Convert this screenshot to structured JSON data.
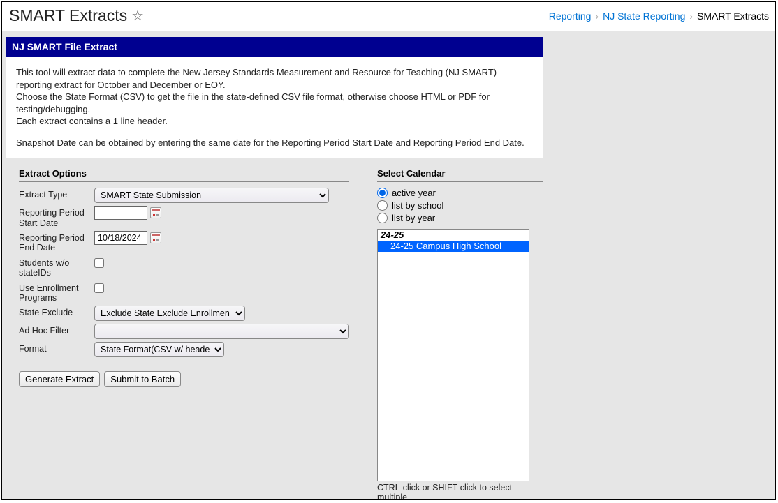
{
  "header": {
    "title": "SMART Extracts",
    "breadcrumb": {
      "reporting": "Reporting",
      "state_reporting": "NJ State Reporting",
      "current": "SMART Extracts"
    }
  },
  "panel": {
    "heading": "NJ SMART File Extract"
  },
  "intro": {
    "para1": "This tool will extract data to complete the New Jersey Standards Measurement and Resource for Teaching (NJ SMART) reporting extract for October and December or EOY.",
    "para2": "Choose the State Format (CSV) to get the file in the state-defined CSV file format, otherwise choose HTML or PDF for testing/debugging.",
    "para3": "Each extract contains a 1 line header.",
    "para4": "Snapshot Date can be obtained by entering the same date for the Reporting Period Start Date and Reporting Period End Date."
  },
  "sections": {
    "extract_options": "Extract Options",
    "select_calendar": "Select Calendar"
  },
  "form": {
    "extract_type": {
      "label": "Extract Type",
      "value": "SMART State Submission"
    },
    "start_date": {
      "label": "Reporting Period Start Date",
      "value": ""
    },
    "end_date": {
      "label": "Reporting Period End Date",
      "value": "10/18/2024"
    },
    "students_wo_id": {
      "label": "Students w/o stateIDs"
    },
    "use_enrollment": {
      "label": "Use Enrollment Programs"
    },
    "state_exclude": {
      "label": "State Exclude",
      "value": "Exclude State Exclude Enrollments"
    },
    "ad_hoc": {
      "label": "Ad Hoc Filter",
      "value": ""
    },
    "format": {
      "label": "Format",
      "value": "State Format(CSV w/ header)"
    }
  },
  "buttons": {
    "generate": "Generate Extract",
    "submit": "Submit to Batch"
  },
  "calendar": {
    "radios": {
      "active_year": "active year",
      "list_by_school": "list by school",
      "list_by_year": "list by year"
    },
    "list": {
      "header": "24-25",
      "item0": "24-25 Campus High School"
    },
    "hint": "CTRL-click or SHIFT-click to select multiple"
  }
}
